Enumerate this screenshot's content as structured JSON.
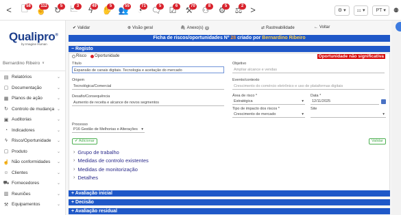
{
  "toolbar": {
    "back": "<",
    "forward": ">",
    "icons": [
      {
        "name": "documents-icon",
        "glyph": "🗋",
        "badge": "58"
      },
      {
        "name": "hand-touch-icon",
        "glyph": "☝",
        "badge": "112"
      },
      {
        "name": "refresh-cycle-icon",
        "glyph": "↻",
        "badge": "5"
      },
      {
        "name": "report-icon",
        "glyph": "🗠",
        "badge": "3"
      },
      {
        "name": "lightning-icon",
        "glyph": "ϟ",
        "badge": "49"
      },
      {
        "name": "hand-raise-icon",
        "glyph": "✋",
        "badge": "5"
      },
      {
        "name": "people-icon",
        "glyph": "👥",
        "badge": "55"
      },
      {
        "name": "gauge-icon",
        "glyph": "◔",
        "badge": "71"
      },
      {
        "name": "speech-icon",
        "glyph": "🗨",
        "badge": "5"
      },
      {
        "name": "checklist-icon",
        "glyph": "☑",
        "badge": "6"
      },
      {
        "name": "tools-icon",
        "glyph": "⚒",
        "badge": "70"
      },
      {
        "name": "certificate-icon",
        "glyph": "⚇",
        "badge": "8"
      },
      {
        "name": "gears-icon",
        "glyph": "⚙",
        "badge": "5"
      },
      {
        "name": "scales-icon",
        "glyph": "⚖",
        "badge": "2"
      }
    ],
    "settings_label": "⚙",
    "grid_label": "⚏",
    "lang_label": "PT"
  },
  "sidebar": {
    "brand": "Qualipro",
    "brand_reg": "®",
    "tagline": "by Imagine Human",
    "user": "Bernardino Ribeiro",
    "user_caret": "∨",
    "items": [
      {
        "label": "Relatórios",
        "icon": "report-icon",
        "glyph": "▤"
      },
      {
        "label": "Documentação",
        "icon": "document-icon",
        "glyph": "▢"
      },
      {
        "label": "Planos de ação",
        "icon": "action-plan-icon",
        "glyph": "▦"
      },
      {
        "label": "Controlo de mudança",
        "icon": "change-control-icon",
        "glyph": "↻"
      },
      {
        "label": "Auditorias",
        "icon": "audit-icon",
        "glyph": "▣"
      },
      {
        "label": "Indicadores",
        "icon": "indicators-icon",
        "glyph": "◔"
      },
      {
        "label": "Risco/Oportunidade",
        "icon": "risk-icon",
        "glyph": "ϟ"
      },
      {
        "label": "Produto",
        "icon": "product-icon",
        "glyph": "▢"
      },
      {
        "label": "Não conformidades",
        "icon": "nonconformity-icon",
        "glyph": "☝"
      },
      {
        "label": "Clientes",
        "icon": "clients-icon",
        "glyph": "☺"
      },
      {
        "label": "Fornecedores",
        "icon": "suppliers-icon",
        "glyph": "⛟"
      },
      {
        "label": "Reuniões",
        "icon": "meetings-icon",
        "glyph": "▥"
      },
      {
        "label": "Equipamentos",
        "icon": "equipment-icon",
        "glyph": "⚒"
      }
    ]
  },
  "actions": {
    "validate": "Validar",
    "overview": "Visão geral",
    "attachments": "Anexo(s)",
    "attachments_count": "0",
    "traceability": "Rastreabilidade",
    "back": "Voltar"
  },
  "title": {
    "prefix": "Ficha de riscos/oportunidades Nº",
    "number": "28",
    "middle": "criado por",
    "author": "Bernardino Ribeiro"
  },
  "registo": {
    "section_label": "Registo",
    "radio_risk": "Risco",
    "radio_opportunity": "Oportunidade",
    "status_label": "Oportunidade não significativa",
    "title_label": "Título",
    "title_value": "Expansão de canais digitais. Tecnologia e aceitação do mercado",
    "objective_label": "Objetivo",
    "objective_value": "Ampliar alcance e vendas",
    "origin_label": "Origem",
    "origin_value": "Tecnológica/Comercial",
    "event_label": "Evento/contexto",
    "event_value": "Crescimento do comércio eletrônico e uso de plataformas digitais",
    "challenge_label": "Desafio/Consequência",
    "challenge_value": "Aumento de receita e alcance de novos segmentos",
    "risk_area_label": "Área de risco *",
    "risk_area_value": "Estratégica",
    "date_label": "Data *",
    "date_value": "12/11/2025",
    "impact_type_label": "Tipo de impacto dos riscos *",
    "impact_type_value": "Crescimento de mercado",
    "site_label": "Site",
    "site_value": "",
    "process_label": "Processo",
    "process_value": "P16 Gestão de Melhorias e Alterações",
    "add_button": "Adicionar",
    "validate_button": "Validar"
  },
  "subsections": [
    "Grupo de trabalho",
    "Medidas de controlo existentes",
    "Medidas de monitorização",
    "Detalhes"
  ],
  "sections": {
    "initial": "Avaliação inicial",
    "decision": "Decisão",
    "residual": "Avaliação residual"
  }
}
